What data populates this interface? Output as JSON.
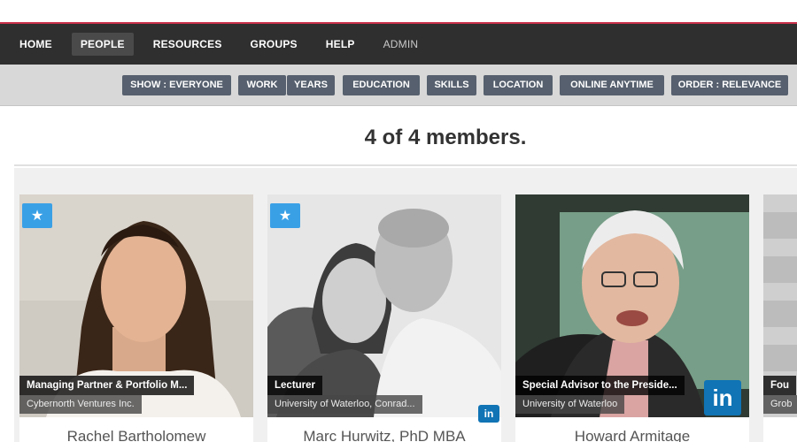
{
  "nav": {
    "items": [
      "HOME",
      "PEOPLE",
      "RESOURCES",
      "GROUPS",
      "HELP",
      "ADMIN"
    ],
    "active": "PEOPLE"
  },
  "filters": {
    "show": "SHOW : EVERYONE",
    "work": "WORK",
    "years": "YEARS",
    "education": "EDUCATION",
    "skills": "SKILLS",
    "location": "LOCATION",
    "online": "ONLINE ANYTIME",
    "order": "ORDER : RELEVANCE"
  },
  "members": {
    "count_text": "4 of 4 members."
  },
  "cards": [
    {
      "role": "Managing Partner & Portfolio M...",
      "org": "Cybernorth Ventures Inc.",
      "name": "Rachel Bartholomew",
      "starred": true,
      "linkedin": false
    },
    {
      "role": "Lecturer",
      "org": "University of Waterloo, Conrad...",
      "name": "Marc Hurwitz, PhD MBA",
      "starred": true,
      "linkedin": true
    },
    {
      "role": "Special Advisor to the Preside...",
      "org": "University of Waterloo",
      "name": "Howard Armitage",
      "starred": false,
      "linkedin": true
    },
    {
      "role": "Fou",
      "org": "Grob",
      "name": "",
      "starred": false,
      "linkedin": false
    }
  ],
  "icons": {
    "star": "star-icon",
    "linkedin": "linkedin-icon",
    "linkedin_text": "in"
  },
  "colors": {
    "nav_bg": "#2f2f2f",
    "accent_line": "#c8304a",
    "filter_button": "#56606e",
    "star_badge": "#3aa0e6",
    "linkedin": "#1074b5"
  }
}
